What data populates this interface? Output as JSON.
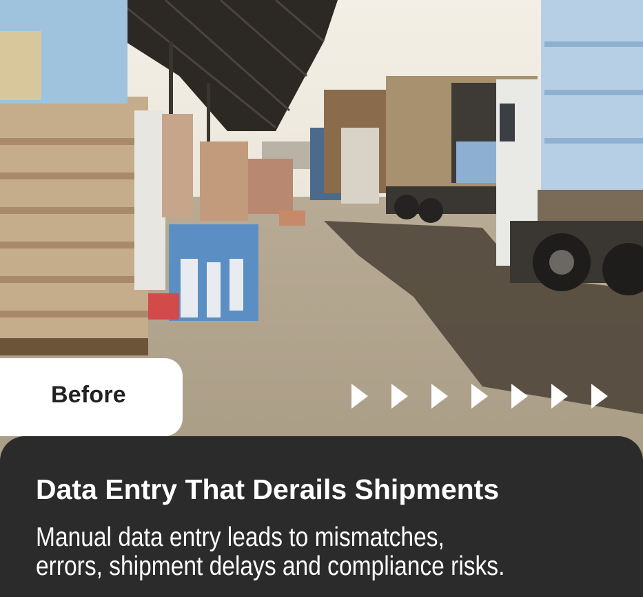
{
  "badge": {
    "label": "Before"
  },
  "arrows": {
    "count": 7,
    "color": "#ffffff"
  },
  "panel": {
    "title": "Data Entry That Derails Shipments",
    "body_lines": [
      "Manual data entry leads to mismatches,",
      "errors, shipment delays and compliance risks."
    ]
  },
  "colors": {
    "panel": "#2b2b2b",
    "badge": "#ffffff",
    "text": "#ffffff",
    "badge_text": "#222222"
  }
}
